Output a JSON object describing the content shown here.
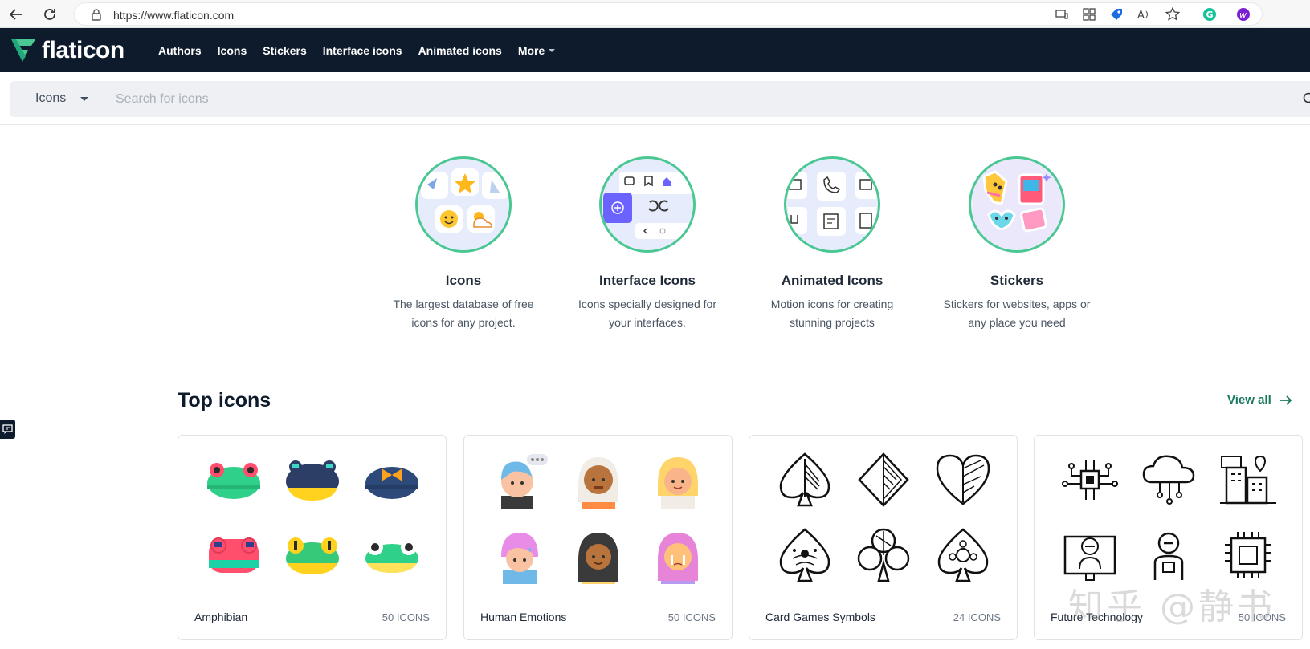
{
  "browser": {
    "url": "https://www.flaticon.com"
  },
  "header": {
    "logo_text": "flaticon",
    "menu": [
      {
        "label": "Authors"
      },
      {
        "label": "Icons"
      },
      {
        "label": "Stickers"
      },
      {
        "label": "Interface icons"
      },
      {
        "label": "Animated icons"
      },
      {
        "label": "More"
      }
    ]
  },
  "search": {
    "type_label": "Icons",
    "placeholder": "Search for icons"
  },
  "categories": [
    {
      "title": "Icons",
      "desc_line1": "The largest database of free",
      "desc_line2": "icons for any project."
    },
    {
      "title": "Interface Icons",
      "desc_line1": "Icons specially designed for",
      "desc_line2": "your interfaces."
    },
    {
      "title": "Animated Icons",
      "desc_line1": "Motion icons for creating",
      "desc_line2": "stunning projects"
    },
    {
      "title": "Stickers",
      "desc_line1": "Stickers for websites, apps or",
      "desc_line2": "any place you need"
    }
  ],
  "top_icons": {
    "title": "Top icons",
    "view_all": "View all",
    "packs": [
      {
        "name": "Amphibian",
        "count": "50 ICONS"
      },
      {
        "name": "Human Emotions",
        "count": "50 ICONS"
      },
      {
        "name": "Card Games Symbols",
        "count": "24 ICONS"
      },
      {
        "name": "Future Technology",
        "count": "50 ICONS"
      }
    ]
  },
  "watermark": "知乎 @静书",
  "colors": {
    "navy": "#0e1b2c",
    "accent_green": "#4bc793",
    "link_green": "#1a7a5f"
  }
}
